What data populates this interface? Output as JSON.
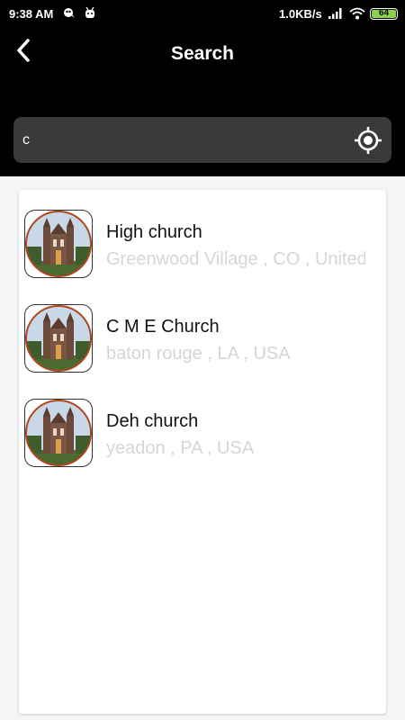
{
  "status_bar": {
    "time": "9:38 AM",
    "network_speed": "1.0KB/s",
    "battery": "64",
    "icons": [
      "notification-icon",
      "android-icon",
      "signal-icon",
      "wifi-icon",
      "battery-icon"
    ]
  },
  "header": {
    "title": "Search",
    "back_icon": "chevron-left-icon"
  },
  "search": {
    "value": "c",
    "locate_icon": "gps-target-icon"
  },
  "results": [
    {
      "name": "High church",
      "address": "Greenwood Village , CO , United States"
    },
    {
      "name": "C M E Church",
      "address": "baton rouge , LA , USA"
    },
    {
      "name": "Deh church",
      "address": "yeadon , PA , USA"
    }
  ],
  "colors": {
    "header_bg": "#000000",
    "search_bg": "#3a3a3a",
    "page_bg": "#f5f5f5",
    "address_text": "#d6d6d6",
    "battery_fill": "#8bd14a"
  }
}
